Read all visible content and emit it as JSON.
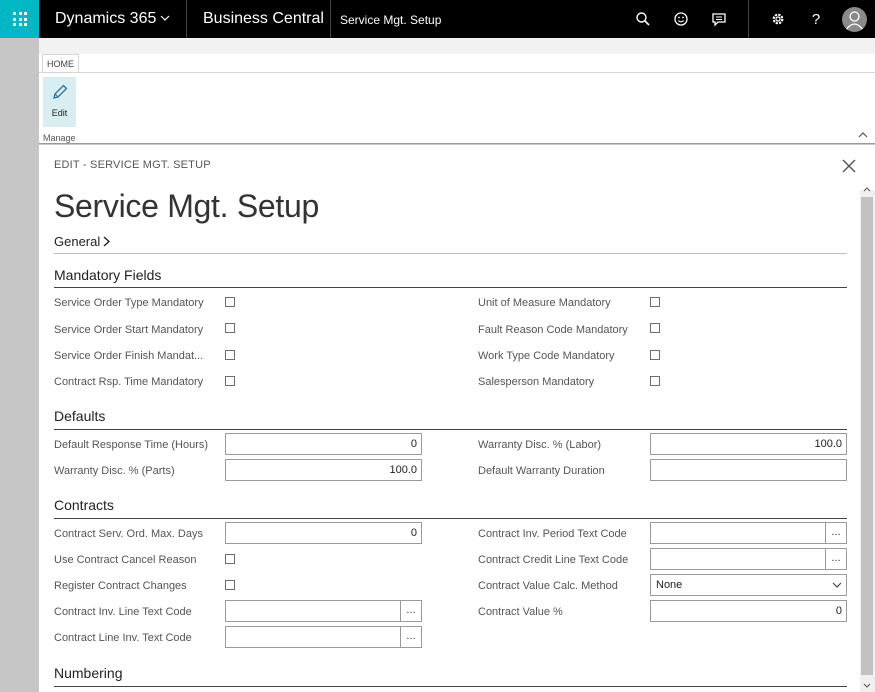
{
  "topbar": {
    "brand": "Dynamics 365",
    "product": "Business Central",
    "breadcrumb": "Service Mgt. Setup"
  },
  "ribbon": {
    "tab": "HOME",
    "edit_label": "Edit",
    "group_label": "Manage"
  },
  "page": {
    "caption": "EDIT - SERVICE MGT. SETUP",
    "title": "Service Mgt. Setup",
    "fasttab": "General"
  },
  "groups": {
    "mandatory": "Mandatory Fields",
    "defaults": "Defaults",
    "contracts": "Contracts",
    "numbering": "Numbering"
  },
  "mandatory": {
    "service_order_type": "Service Order Type Mandatory",
    "service_order_start": "Service Order Start Mandatory",
    "service_order_finish": "Service Order Finish Mandat...",
    "contract_rsp_time": "Contract Rsp. Time Mandatory",
    "unit_of_measure": "Unit of Measure Mandatory",
    "fault_reason_code": "Fault Reason Code Mandatory",
    "work_type_code": "Work Type Code Mandatory",
    "salesperson": "Salesperson Mandatory"
  },
  "defaults": {
    "response_time_label": "Default Response Time (Hours)",
    "response_time_value": "0",
    "disc_parts_label": "Warranty Disc. % (Parts)",
    "disc_parts_value": "100.0",
    "disc_labor_label": "Warranty Disc. % (Labor)",
    "disc_labor_value": "100.0",
    "warranty_duration_label": "Default Warranty Duration",
    "warranty_duration_value": ""
  },
  "contracts": {
    "max_days_label": "Contract Serv. Ord. Max. Days",
    "max_days_value": "0",
    "cancel_reason_label": "Use Contract Cancel Reason",
    "register_changes_label": "Register Contract Changes",
    "inv_line_text_label": "Contract Inv. Line Text Code",
    "inv_line_text_value": "",
    "line_inv_text_label": "Contract Line Inv. Text Code",
    "line_inv_text_value": "",
    "inv_period_text_label": "Contract Inv. Period Text Code",
    "inv_period_text_value": "",
    "credit_line_text_label": "Contract Credit Line Text Code",
    "credit_line_text_value": "",
    "value_calc_label": "Contract Value Calc. Method",
    "value_calc_value": "None",
    "value_pct_label": "Contract Value %",
    "value_pct_value": "0",
    "lookup_glyph": "..."
  },
  "colors": {
    "accent": "#00b7c3",
    "topbar": "#000000",
    "edit_button_bg": "#d8eef0"
  }
}
